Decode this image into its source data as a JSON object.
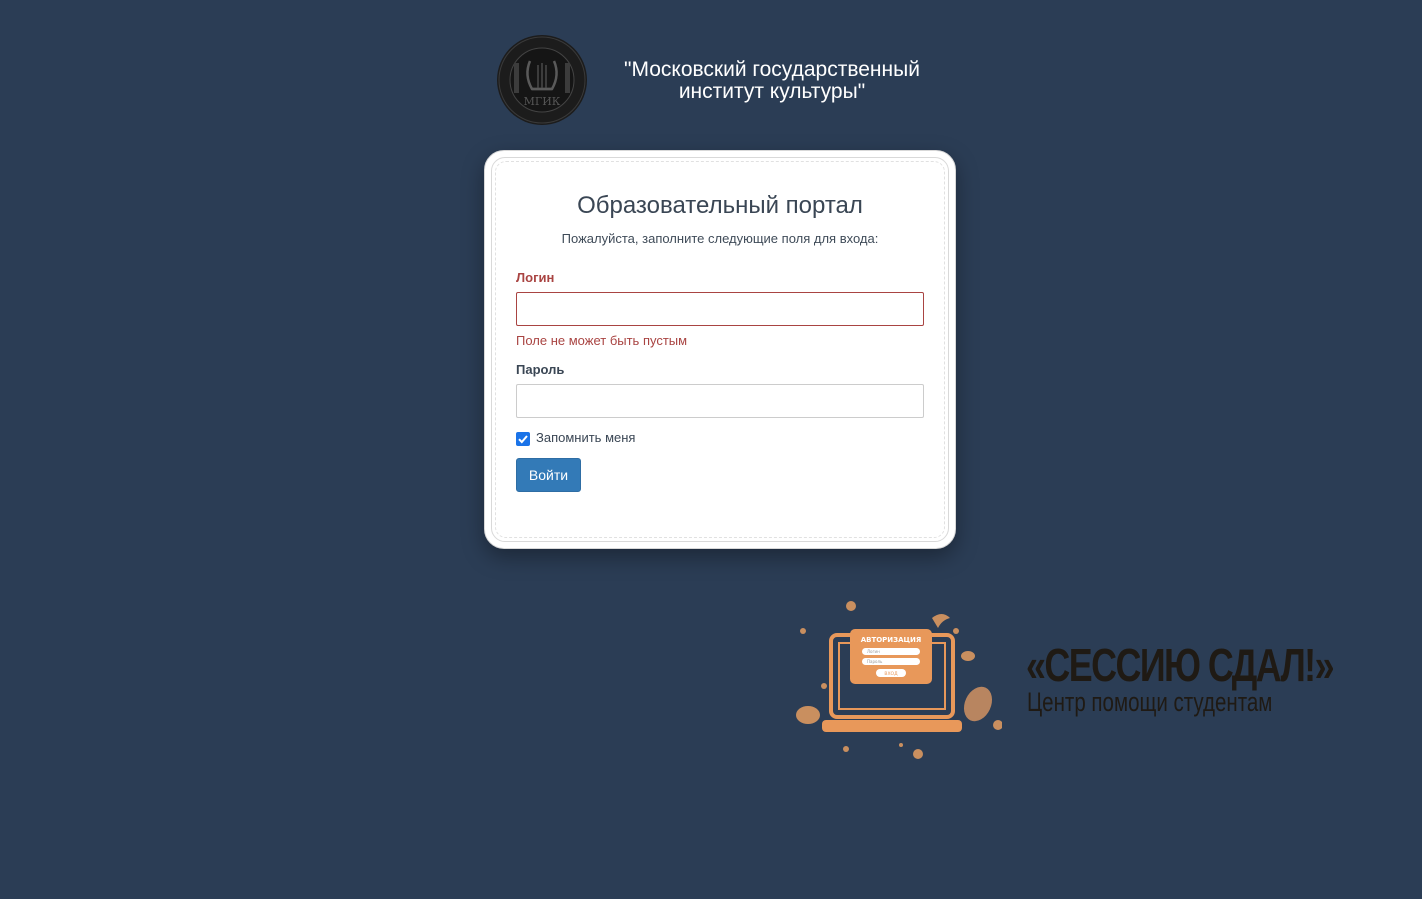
{
  "header": {
    "institute_title_line1": "\"Московский государственный",
    "institute_title_line2": "институт культуры\"",
    "logo_icon": "lyre-emblem-icon",
    "logo_text": "МГИК"
  },
  "login_form": {
    "title": "Образовательный портал",
    "subtitle": "Пожалуйста, заполните следующие поля для входа:",
    "login_label": "Логин",
    "login_value": "",
    "login_error": "Поле не может быть пустым",
    "password_label": "Пароль",
    "password_value": "",
    "remember_label": "Запомнить меня",
    "remember_checked": true,
    "submit_label": "Войти"
  },
  "promo": {
    "title": "«СЕССИЮ СДАЛ!»",
    "subtitle": "Центр помощи студентам",
    "illustration_icon": "laptop-login-icon",
    "illustration_text": {
      "header": "АВТОРИЗАЦИЯ",
      "field1": "Логин",
      "field2": "Пароль",
      "button": "ВХОД"
    }
  },
  "colors": {
    "background": "#2b3d55",
    "error": "#a94442",
    "primary_button": "#337ab7",
    "accent_orange": "#e8985a"
  }
}
